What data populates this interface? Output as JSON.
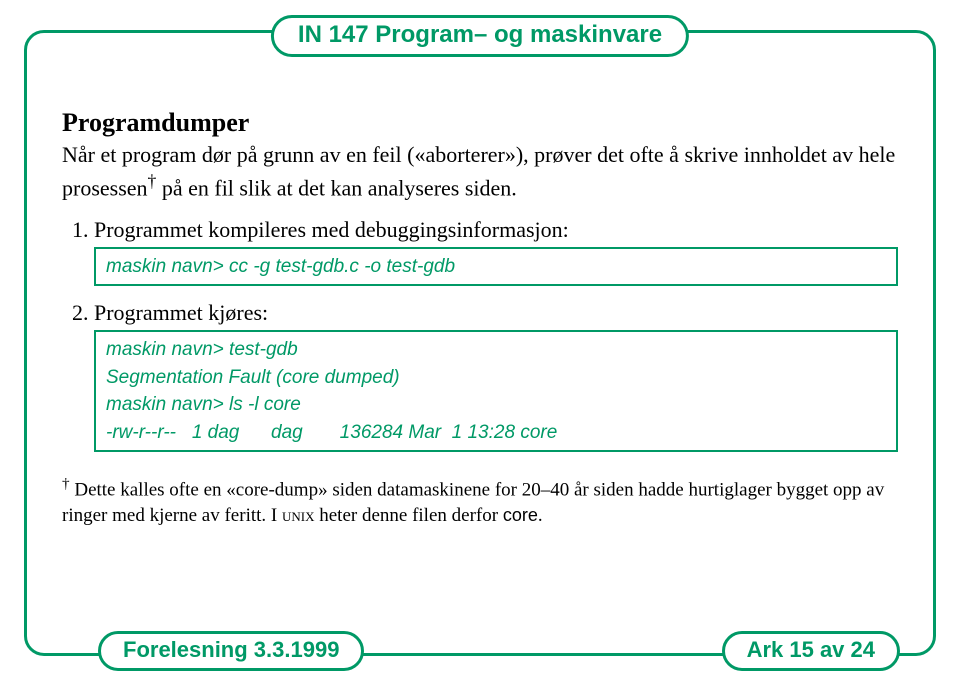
{
  "course_title": "IN 147 Program– og maskinvare",
  "heading": "Programdumper",
  "intro_part1": "Når et program dør på grunn av en feil («aborterer»), prøver det ofte å skrive innholdet av hele prosessen",
  "intro_part2": " på en fil slik at det kan analyseres siden.",
  "steps": [
    {
      "text": "Programmet kompileres med debuggingsinformasjon:",
      "code": "maskin navn> cc -g test-gdb.c -o test-gdb"
    },
    {
      "text": "Programmet kjøres:",
      "code": "maskin navn> test-gdb\nSegmentation Fault (core dumped)\nmaskin navn> ls -l core\n-rw-r--r--   1 dag      dag       136284 Mar  1 13:28 core"
    }
  ],
  "footnote_lead": " Dette kalles ofte en «core-dump» siden datamaskinene for 20–40 år siden hadde hurtiglager bygget opp av ringer med kjerne av feritt. I ",
  "footnote_unix": "unix",
  "footnote_tail": " heter denne filen derfor ",
  "footnote_code": "core",
  "footnote_period": ".",
  "footer_left": "Forelesning 3.3.1999",
  "footer_right": "Ark 15 av 24"
}
